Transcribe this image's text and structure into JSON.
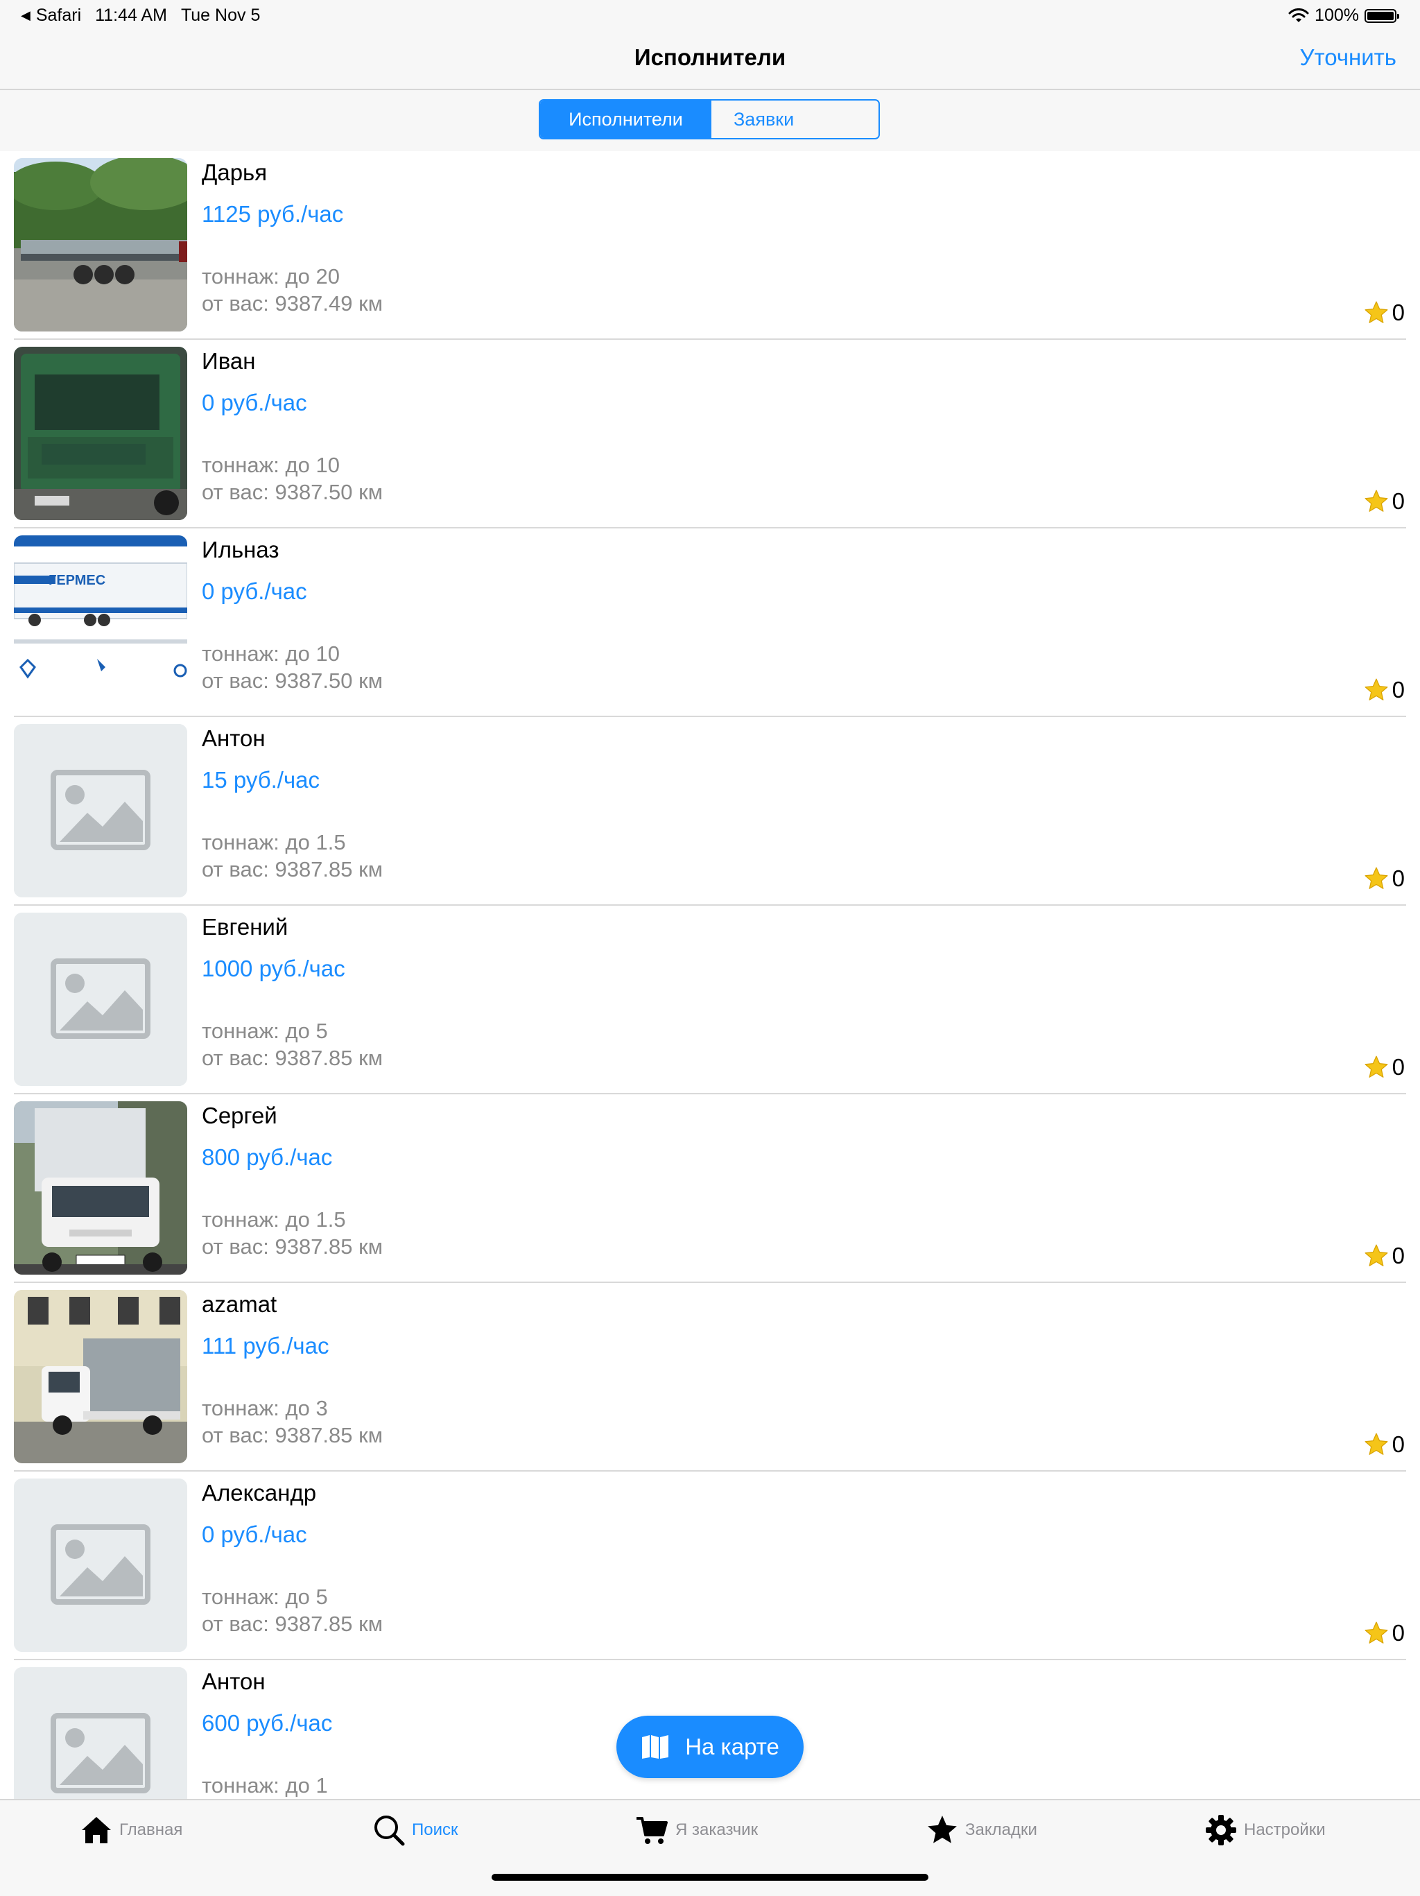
{
  "status_bar": {
    "back_app": "Safari",
    "time": "11:44 AM",
    "date": "Tue Nov 5",
    "battery": "100%"
  },
  "nav": {
    "title": "Исполнители",
    "right_action": "Уточнить"
  },
  "segments": {
    "active": "Исполнители",
    "inactive": "Заявки"
  },
  "rows": [
    {
      "name": "Дарья",
      "price": "1125 руб./час",
      "tonnage": "тоннаж: до 20",
      "distance": "от вас: 9387.49 км",
      "rating": "0",
      "image": "truck-flatbed-photo"
    },
    {
      "name": "Иван",
      "price": "0 руб./час",
      "tonnage": "тоннаж: до 10",
      "distance": "от вас: 9387.50 км",
      "rating": "0",
      "image": "green-truck-photo"
    },
    {
      "name": "Ильназ",
      "price": "0 руб./час",
      "tonnage": "тоннаж: до 10",
      "distance": "от вас: 9387.50 км",
      "rating": "0",
      "image": "germes-ad-photo",
      "image_text": "ГЕРМЕС"
    },
    {
      "name": "Антон",
      "price": "15 руб./час",
      "tonnage": "тоннаж: до 1.5",
      "distance": "от вас: 9387.85 км",
      "rating": "0",
      "image": "placeholder-image"
    },
    {
      "name": "Евгений",
      "price": "1000 руб./час",
      "tonnage": "тоннаж: до 5",
      "distance": "от вас: 9387.85 км",
      "rating": "0",
      "image": "placeholder-image"
    },
    {
      "name": "Сергей",
      "price": "800 руб./час",
      "tonnage": "тоннаж: до 1.5",
      "distance": "от вас: 9387.85 км",
      "rating": "0",
      "image": "box-truck-photo"
    },
    {
      "name": "azamat",
      "price": "111 руб./час",
      "tonnage": "тоннаж: до 3",
      "distance": "от вас: 9387.85 км",
      "rating": "0",
      "image": "gazelle-truck-photo"
    },
    {
      "name": "Александр",
      "price": "0 руб./час",
      "tonnage": "тоннаж: до 5",
      "distance": "от вас: 9387.85 км",
      "rating": "0",
      "image": "placeholder-image"
    },
    {
      "name": "Антон",
      "price": "600 руб./час",
      "tonnage": "тоннаж: до 1",
      "distance": "",
      "rating": "",
      "image": "placeholder-image"
    }
  ],
  "map_button": {
    "label": "На карте"
  },
  "tabs": [
    {
      "label": "Главная",
      "icon": "home-icon",
      "active": false
    },
    {
      "label": "Поиск",
      "icon": "search-icon",
      "active": true
    },
    {
      "label": "Я заказчик",
      "icon": "cart-icon",
      "active": false
    },
    {
      "label": "Закладки",
      "icon": "star-icon",
      "active": false
    },
    {
      "label": "Настройки",
      "icon": "gear-icon",
      "active": false
    }
  ],
  "colors": {
    "accent": "#1a8cff",
    "muted_text": "#8a8a8a",
    "star": "#f5c518",
    "placeholder_bg": "#e8ecee"
  }
}
